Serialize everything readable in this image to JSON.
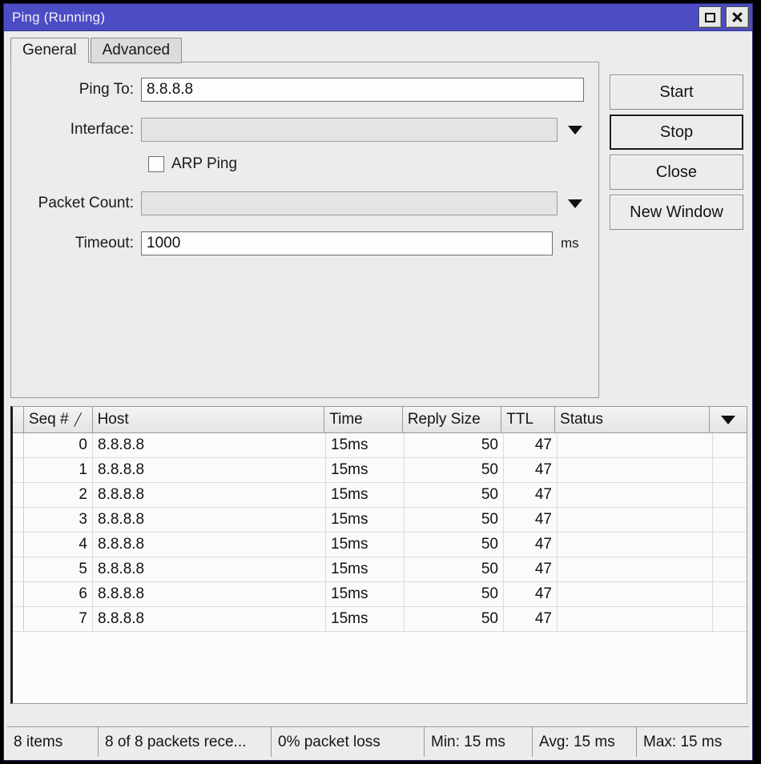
{
  "window": {
    "title": "Ping (Running)",
    "title_bar_color": "#4c4cc4",
    "restore_button_name": "restore",
    "close_button_name": "close"
  },
  "tabs": [
    {
      "label": "General",
      "active": true
    },
    {
      "label": "Advanced",
      "active": false
    }
  ],
  "form": {
    "ping_to": {
      "label": "Ping To:",
      "value": "8.8.8.8",
      "placeholder": ""
    },
    "interface": {
      "label": "Interface:",
      "value": "",
      "placeholder": "",
      "disabled": true,
      "has_dropdown": true
    },
    "arp_ping": {
      "label": "ARP Ping",
      "checked": false
    },
    "packet_count": {
      "label": "Packet Count:",
      "value": "",
      "placeholder": "",
      "disabled": true,
      "has_dropdown": true
    },
    "timeout": {
      "label": "Timeout:",
      "value": "1000",
      "placeholder": "",
      "unit": "ms"
    }
  },
  "actions": [
    {
      "label": "Start",
      "default": false
    },
    {
      "label": "Stop",
      "default": true
    },
    {
      "label": "Close",
      "default": false
    },
    {
      "label": "New Window",
      "default": false
    }
  ],
  "table": {
    "columns": [
      {
        "key": "seq",
        "label": "Seq #",
        "sort_indicator": "╱"
      },
      {
        "key": "host",
        "label": "Host"
      },
      {
        "key": "time",
        "label": "Time"
      },
      {
        "key": "size",
        "label": "Reply Size"
      },
      {
        "key": "ttl",
        "label": "TTL"
      },
      {
        "key": "status",
        "label": "Status"
      }
    ],
    "menu_icon": "chevron-down-icon",
    "rows": [
      {
        "seq": "0",
        "host": "8.8.8.8",
        "time": "15ms",
        "size": "50",
        "ttl": "47",
        "status": ""
      },
      {
        "seq": "1",
        "host": "8.8.8.8",
        "time": "15ms",
        "size": "50",
        "ttl": "47",
        "status": ""
      },
      {
        "seq": "2",
        "host": "8.8.8.8",
        "time": "15ms",
        "size": "50",
        "ttl": "47",
        "status": ""
      },
      {
        "seq": "3",
        "host": "8.8.8.8",
        "time": "15ms",
        "size": "50",
        "ttl": "47",
        "status": ""
      },
      {
        "seq": "4",
        "host": "8.8.8.8",
        "time": "15ms",
        "size": "50",
        "ttl": "47",
        "status": ""
      },
      {
        "seq": "5",
        "host": "8.8.8.8",
        "time": "15ms",
        "size": "50",
        "ttl": "47",
        "status": ""
      },
      {
        "seq": "6",
        "host": "8.8.8.8",
        "time": "15ms",
        "size": "50",
        "ttl": "47",
        "status": ""
      },
      {
        "seq": "7",
        "host": "8.8.8.8",
        "time": "15ms",
        "size": "50",
        "ttl": "47",
        "status": ""
      }
    ]
  },
  "statusbar": {
    "items": [
      "8 items",
      "8 of 8 packets rece...",
      "0% packet loss",
      "Min: 15 ms",
      "Avg: 15 ms",
      "Max: 15 ms"
    ]
  }
}
